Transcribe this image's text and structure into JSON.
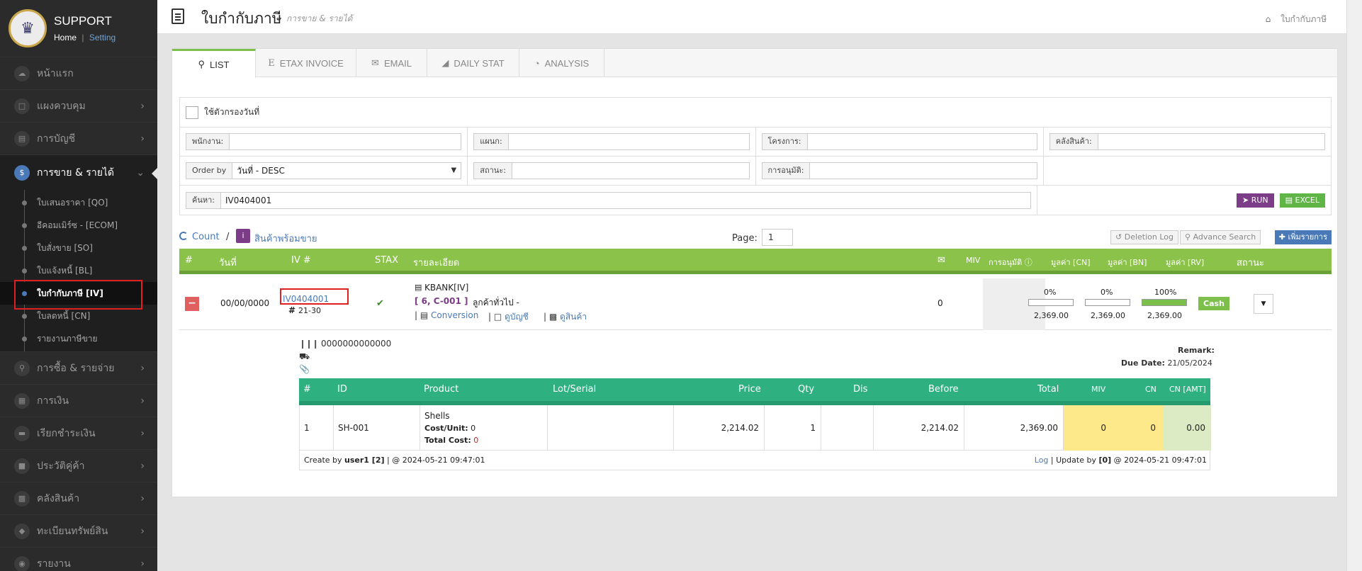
{
  "brand": {
    "title": "SUPPORT",
    "home": "Home",
    "sep": "|",
    "setting": "Setting"
  },
  "sidebar": {
    "items": [
      {
        "label": "หน้าแรก",
        "icon": "cloud-icon"
      },
      {
        "label": "แผงควบคุม",
        "icon": "monitor-icon"
      },
      {
        "label": "การบัญชี",
        "icon": "book-icon"
      },
      {
        "label": "การขาย & รายได้",
        "icon": "dollar-icon",
        "active": true
      },
      {
        "label": "การซื้อ & รายจ่าย",
        "icon": "cart-icon"
      },
      {
        "label": "การเงิน",
        "icon": "calendar-icon"
      },
      {
        "label": "เรียกชำระเงิน",
        "icon": "card-icon"
      },
      {
        "label": "ประวัติคู่ค้า",
        "icon": "contact-icon"
      },
      {
        "label": "คลังสินค้า",
        "icon": "boxes-icon"
      },
      {
        "label": "ทะเบียนทรัพย์สิน",
        "icon": "diamond-icon"
      },
      {
        "label": "รายงาน",
        "icon": "report-icon"
      }
    ],
    "submenu": [
      {
        "label": "ใบเสนอราคา [QO]"
      },
      {
        "label": "อีคอมเมิร์ซ - [ECOM]"
      },
      {
        "label": "ใบสั่งขาย [SO]"
      },
      {
        "label": "ใบแจ้งหนี้ [BL]"
      },
      {
        "label": "ใบกำกับภาษี [IV]",
        "active": true
      },
      {
        "label": "ใบลดหนี้ [CN]"
      },
      {
        "label": "รายงานภาษีขาย"
      }
    ]
  },
  "header": {
    "title": "ใบกำกับภาษี",
    "subtitle": "การขาย & รายได้",
    "breadcrumb": "ใบกำกับภาษี"
  },
  "tabs": [
    {
      "label": "LIST",
      "icon": "search-icon",
      "active": true
    },
    {
      "label": "ETAX INVOICE",
      "icon": "etax-icon"
    },
    {
      "label": "EMAIL",
      "icon": "envelope-icon"
    },
    {
      "label": "DAILY STAT",
      "icon": "area-chart-icon"
    },
    {
      "label": "ANALYSIS",
      "icon": "pie-chart-icon"
    }
  ],
  "filters": {
    "date_filter_label": "ใช้ตัวกรองวันที่",
    "employee_label": "พนักงาน:",
    "employee_value": "",
    "department_label": "แผนก:",
    "department_value": "",
    "project_label": "โครงการ:",
    "project_value": "",
    "warehouse_label": "คลังสินค้า:",
    "warehouse_value": "",
    "orderby_label": "Order by",
    "orderby_value": "วันที่ - DESC",
    "status_label": "สถานะ:",
    "status_value": "",
    "approval_label": "การอนุมัติ:",
    "approval_value": "",
    "search_label": "ค้นหา:",
    "search_value": "IV0404001",
    "run_label": "RUN",
    "excel_label": "EXCEL"
  },
  "listbar": {
    "count_label": "Count",
    "sep": "/",
    "info": "i",
    "ready_label": "สินค้าพร้อมขาย",
    "page_label": "Page:",
    "page_value": "1",
    "deletion_log": "Deletion Log",
    "advance_search": "Advance Search",
    "add_item": "เพิ่มรายการ"
  },
  "table": {
    "headers": {
      "num": "#",
      "date": "วันที่",
      "iv": "IV #",
      "stax": "STAX",
      "detail": "รายละเอียด",
      "miv": "MIV",
      "approval": "การอนุมัติ",
      "cn": "มูลค่า [CN]",
      "bn": "มูลค่า [BN]",
      "rv": "มูลค่า [RV]",
      "status": "สถานะ"
    },
    "row": {
      "date": "00/00/0000",
      "iv_no": "IV0404001",
      "hash": "#",
      "range": "21-30",
      "bank": "KBANK[IV]",
      "customer_code": "[ 6, C-001 ]",
      "customer_name": "ลูกค้าทั่วไป -",
      "conversion": "Conversion",
      "view_account": "ดูบัญชี",
      "view_product": "ดูสินค้า",
      "miv": "0",
      "cn_pct": "0%",
      "cn_fill": 0,
      "cn_val": "2,369.00",
      "bn_pct": "0%",
      "bn_fill": 0,
      "bn_val": "2,369.00",
      "rv_pct": "100%",
      "rv_fill": 100,
      "rv_val": "2,369.00",
      "status": "Cash"
    }
  },
  "detail": {
    "barcode": "0000000000000",
    "remark_label": "Remark:",
    "due_label": "Due Date:",
    "due_value": "21/05/2024",
    "headers": {
      "num": "#",
      "id": "ID",
      "product": "Product",
      "lot": "Lot/Serial",
      "price": "Price",
      "qty": "Qty",
      "dis": "Dis",
      "before": "Before",
      "total": "Total",
      "miv": "MIV",
      "cn": "CN",
      "cn_amt": "CN [AMT]"
    },
    "row": {
      "num": "1",
      "id": "SH-001",
      "product": "Shells",
      "cost_unit_label": "Cost/Unit:",
      "cost_unit": "0",
      "total_cost_label": "Total Cost:",
      "total_cost": "0",
      "lot": "",
      "price": "2,214.02",
      "qty": "1",
      "dis": "",
      "before": "2,214.02",
      "total": "2,369.00",
      "miv": "0",
      "cn": "0",
      "cn_amt": "0.00"
    },
    "footer": {
      "create_by": "Create by",
      "user": "user1 [2]",
      "at_created": "| @ 2024-05-21 09:47:01",
      "log": "Log",
      "update_by": "| Update by",
      "updater": "[0]",
      "at_updated": "@ 2024-05-21 09:47:01"
    }
  }
}
